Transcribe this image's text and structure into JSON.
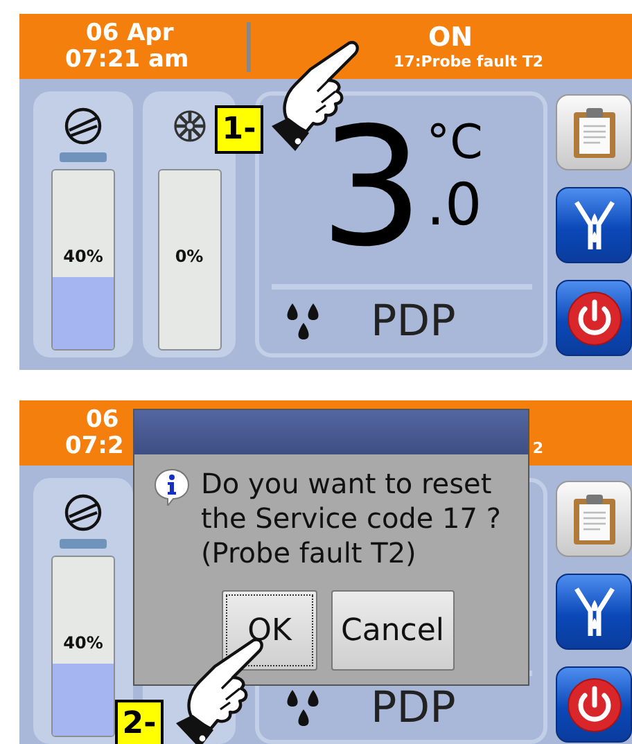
{
  "screens": [
    {
      "header": {
        "date": "06 Apr",
        "time": "07:21 am",
        "status": "ON",
        "fault": "17:Probe fault T2"
      },
      "gauges": [
        {
          "kind": "compressor",
          "running": true,
          "level": 0.4,
          "reading": "40%"
        },
        {
          "kind": "fan",
          "running": false,
          "level": 0,
          "reading": "0%"
        }
      ],
      "readout": {
        "value": "3",
        "unit": "°C",
        "decimal": ".0",
        "label": "PDP"
      },
      "side_buttons": [
        {
          "kind": "log"
        },
        {
          "kind": "drain"
        },
        {
          "kind": "power"
        }
      ],
      "step": {
        "label": "1-"
      }
    },
    {
      "header": {
        "date": "06",
        "time": "07:2",
        "fault": "2"
      },
      "gauges": [
        {
          "kind": "compressor",
          "running": true,
          "level": 0.4,
          "reading": "40%"
        }
      ],
      "readout": {
        "label": "PDP"
      },
      "side_buttons": [
        {
          "kind": "log"
        },
        {
          "kind": "drain"
        },
        {
          "kind": "power"
        }
      ],
      "dialog": {
        "lines": [
          "Do you want to reset",
          "the Service code 17 ?",
          "(Probe fault T2)"
        ],
        "buttons": [
          {
            "label": "OK",
            "focused": true
          },
          {
            "label": "Cancel",
            "focused": false
          }
        ]
      },
      "step": {
        "label": "2-"
      }
    }
  ]
}
